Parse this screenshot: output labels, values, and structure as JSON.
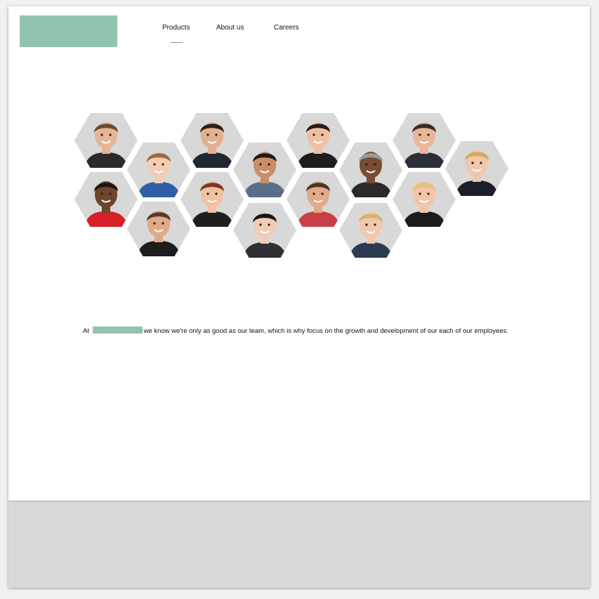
{
  "nav": {
    "items": [
      {
        "label": "Products"
      },
      {
        "label": "About us"
      },
      {
        "label": "Careers"
      }
    ]
  },
  "team_photos": [
    {
      "icon": "person-photo",
      "skin": "#e7b596",
      "hair": "#6b4a32",
      "shirt": "#2a2a2a"
    },
    {
      "icon": "person-photo",
      "skin": "#f2cdb4",
      "hair": "#9a6a45",
      "shirt": "#2f5ea7"
    },
    {
      "icon": "person-photo",
      "skin": "#e3b08f",
      "hair": "#2e211b",
      "shirt": "#1f2733"
    },
    {
      "icon": "person-photo",
      "skin": "#c98e67",
      "hair": "#1f1a17",
      "shirt": "#5a6e8c"
    },
    {
      "icon": "person-photo",
      "skin": "#efc1a3",
      "hair": "#2a1c16",
      "shirt": "#1d1d1d"
    },
    {
      "icon": "person-photo",
      "skin": "#7a4d32",
      "hair": "#9b9b9b",
      "shirt": "#2a2a2a"
    },
    {
      "icon": "person-photo",
      "skin": "#e9b798",
      "hair": "#3a2c23",
      "shirt": "#2b2f3a"
    },
    {
      "icon": "person-photo",
      "skin": "#f0c7ad",
      "hair": "#d6a85d",
      "shirt": "#1a1f2b"
    },
    {
      "icon": "person-photo",
      "skin": "#6e452c",
      "hair": "#1a1412",
      "shirt": "#d61f26"
    },
    {
      "icon": "person-photo",
      "skin": "#e1a987",
      "hair": "#5a3a28",
      "shirt": "#1c1c1c"
    },
    {
      "icon": "person-photo",
      "skin": "#f0c1a4",
      "hair": "#7a3a22",
      "shirt": "#1e1e1e"
    },
    {
      "icon": "person-photo",
      "skin": "#efcdb5",
      "hair": "#1b1716",
      "shirt": "#2e3034"
    },
    {
      "icon": "person-photo",
      "skin": "#e4a987",
      "hair": "#4a3526",
      "shirt": "#c93f46"
    },
    {
      "icon": "person-photo",
      "skin": "#f1c8ad",
      "hair": "#d9b36b",
      "shirt": "#2d3b52"
    },
    {
      "icon": "person-photo",
      "skin": "#f1c5aa",
      "hair": "#e3c27e",
      "shirt": "#1c1c1c"
    }
  ],
  "intro": {
    "prefix": "At",
    "text": "we know we're only as good as our team, which is why focus on the growth and development of our each of our employees."
  },
  "colors": {
    "brand": "#92c4ad",
    "hex_bg": "#d8d8d8",
    "footer_bg": "#d9d9d9"
  }
}
